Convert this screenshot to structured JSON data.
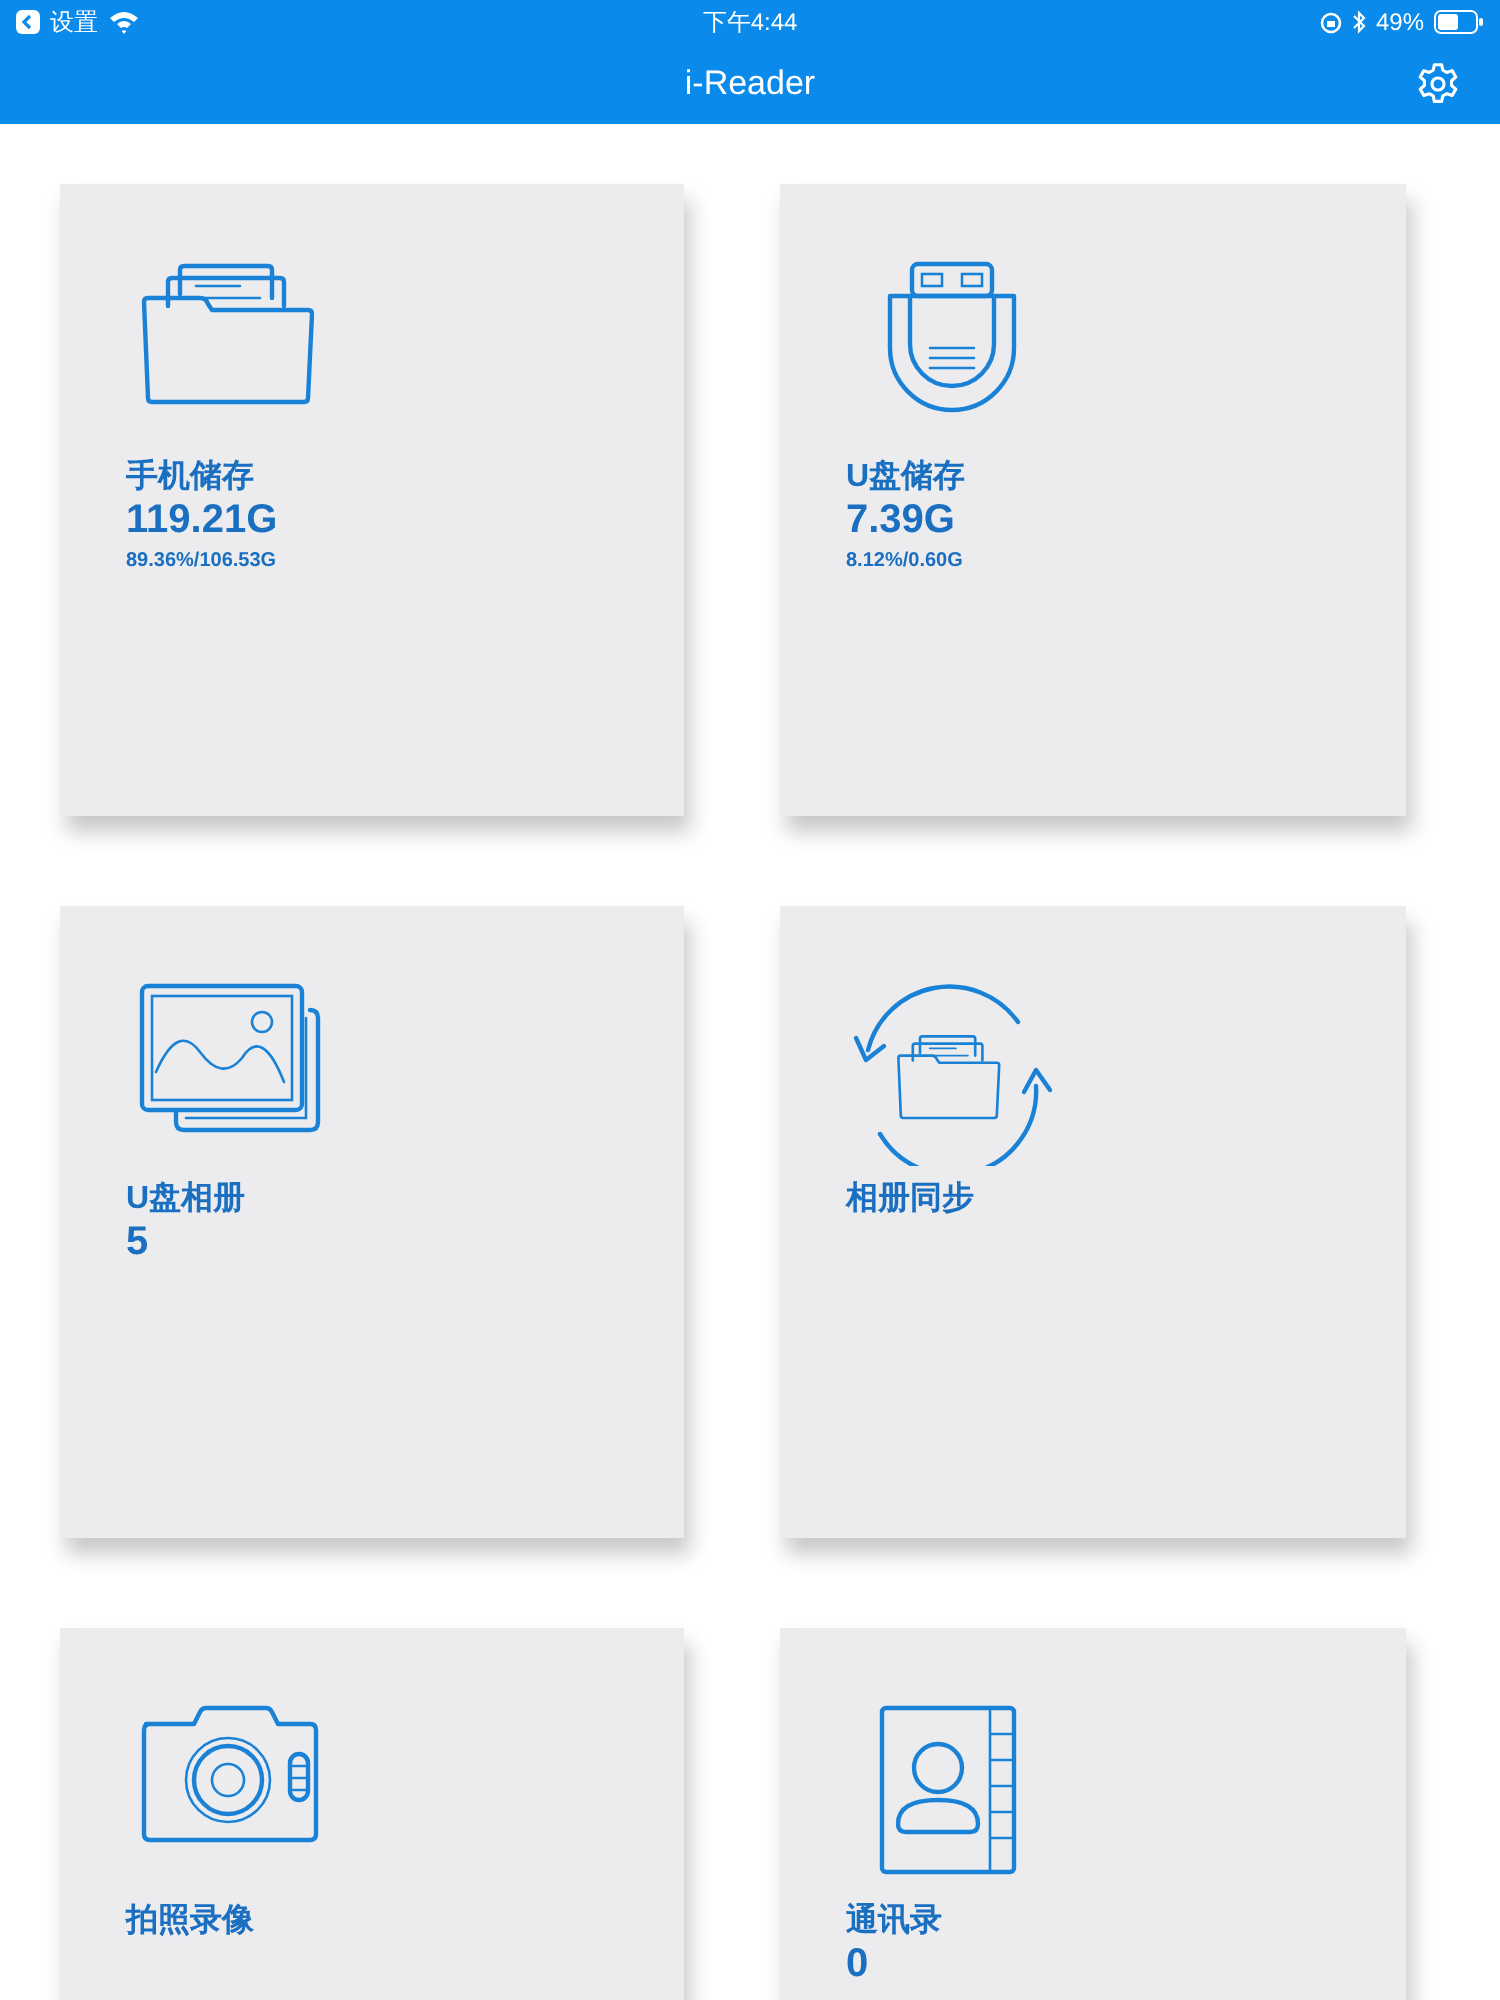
{
  "status_bar": {
    "back_label": "设置",
    "time": "下午4:44",
    "battery": "49%"
  },
  "nav_bar": {
    "title": "i-Reader"
  },
  "tiles": [
    {
      "kind": "folder",
      "title": "手机储存",
      "value": "119.21G",
      "detail": "89.36%/106.53G"
    },
    {
      "kind": "usb",
      "title": "U盘储存",
      "value": "7.39G",
      "detail": "8.12%/0.60G"
    },
    {
      "kind": "photos",
      "title": "U盘相册",
      "value": "5"
    },
    {
      "kind": "sync",
      "title": "相册同步"
    },
    {
      "kind": "camera",
      "title": "拍照录像"
    },
    {
      "kind": "contacts",
      "title": "通讯录",
      "value": "0"
    }
  ]
}
